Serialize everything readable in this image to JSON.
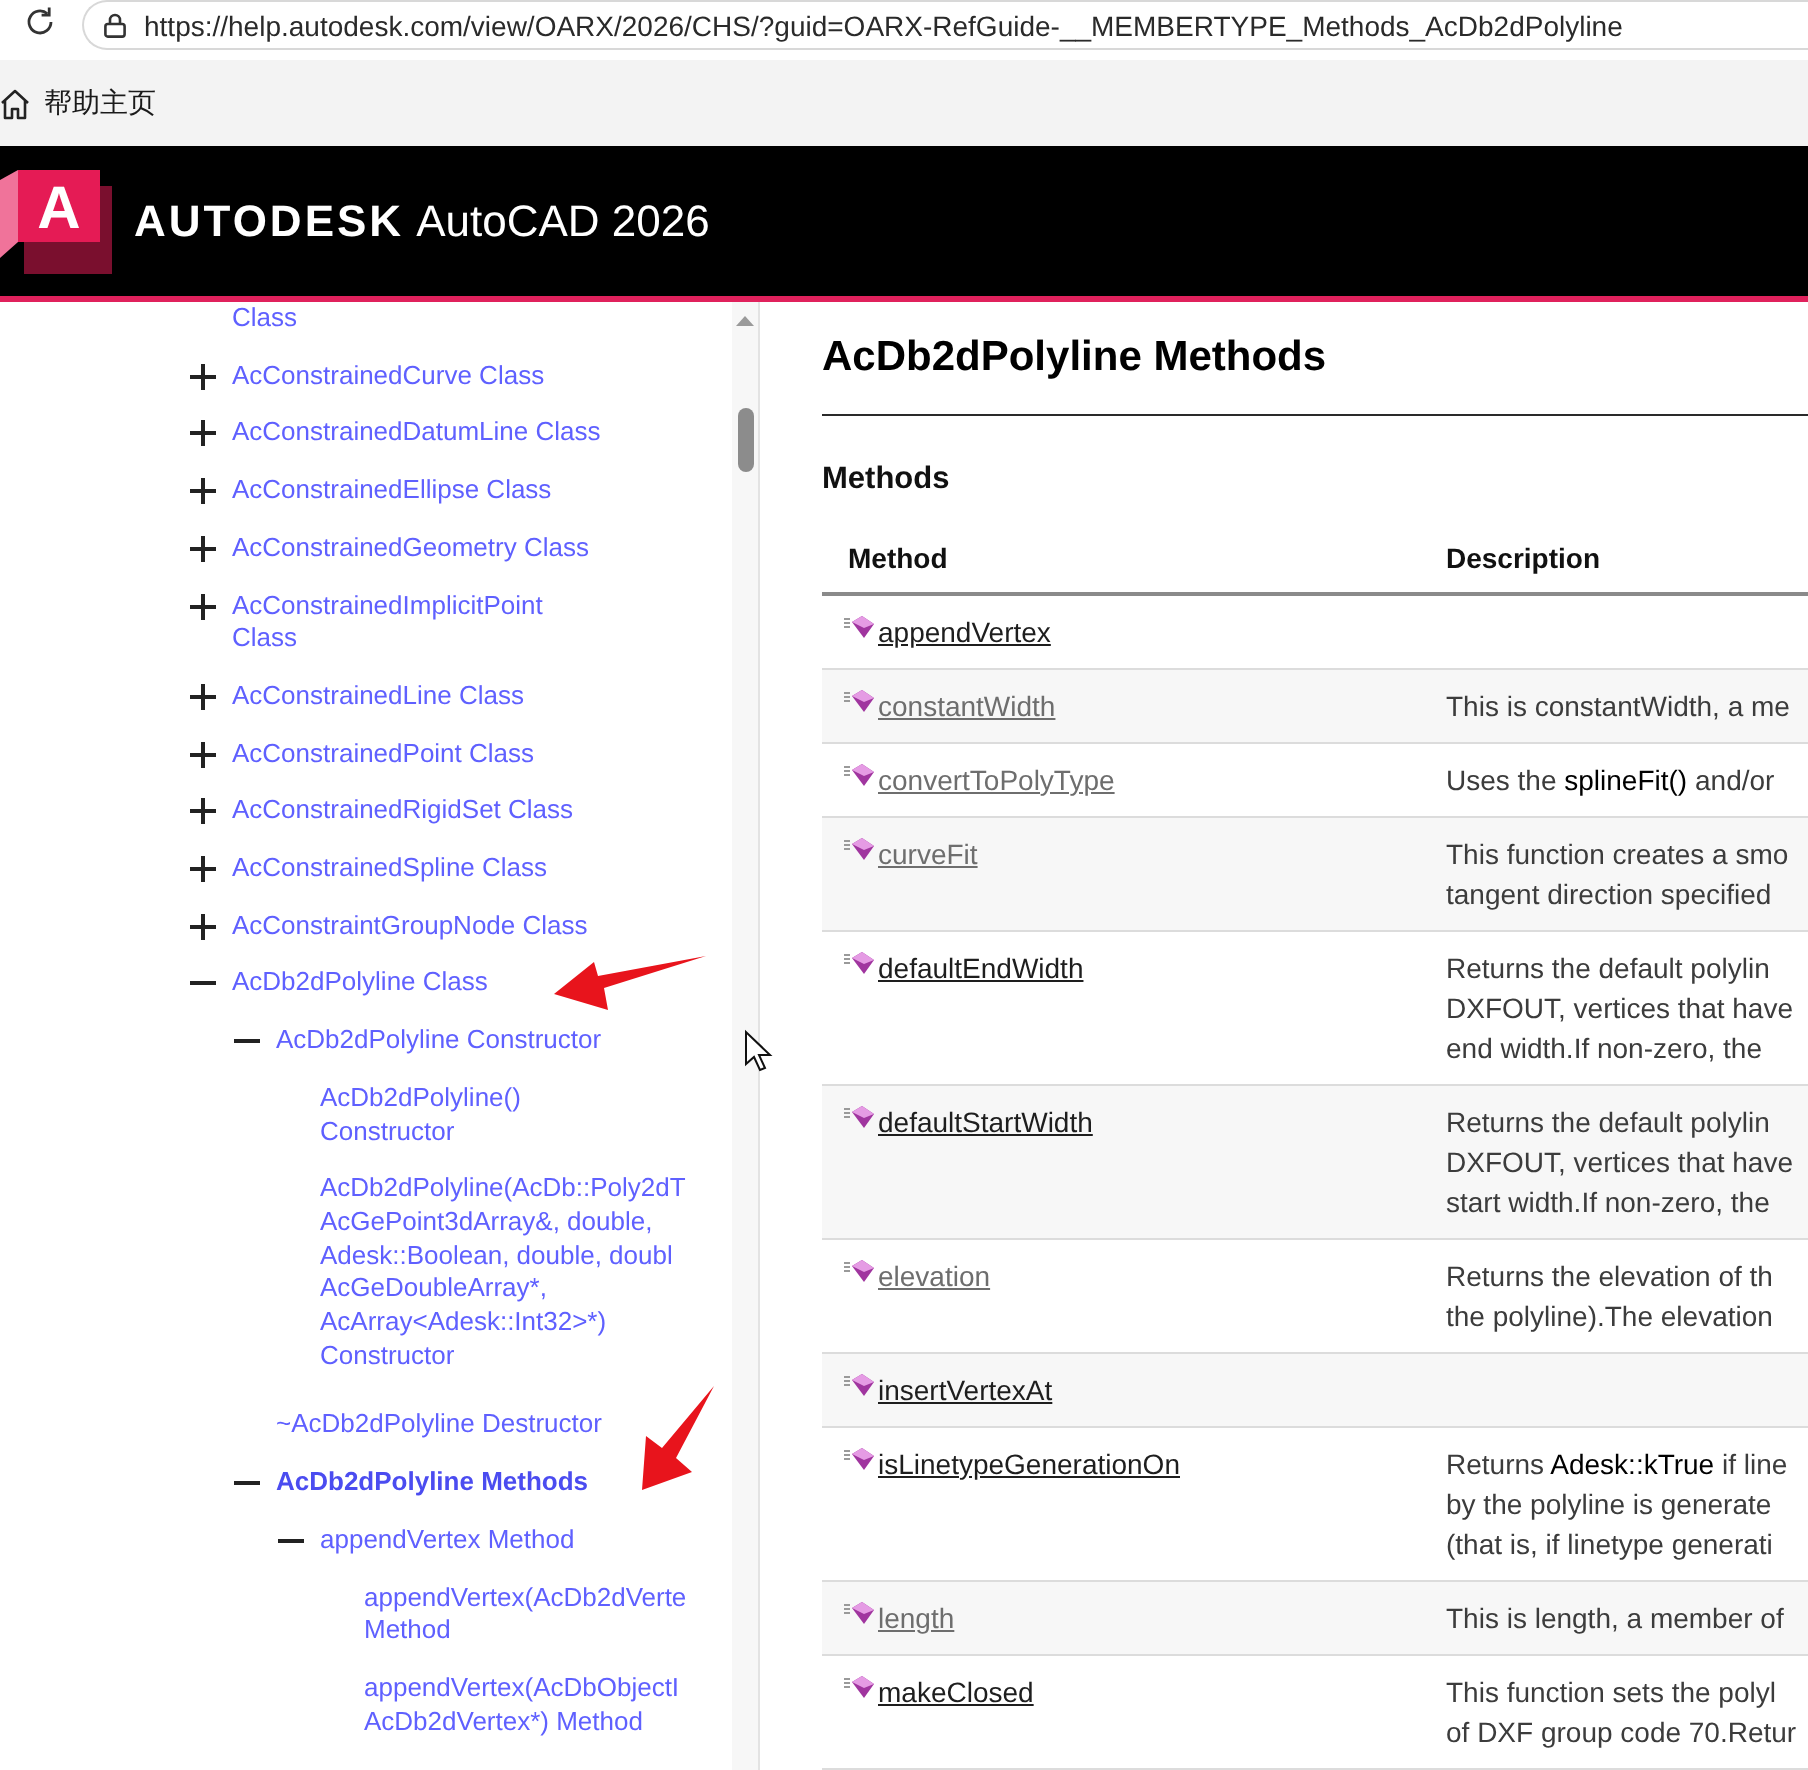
{
  "browser": {
    "url": "https://help.autodesk.com/view/OARX/2026/CHS/?guid=OARX-RefGuide-__MEMBERTYPE_Methods_AcDb2dPolyline"
  },
  "bookmarks_bar": {
    "items": [
      {
        "label": "帮助主页"
      }
    ]
  },
  "header": {
    "logo_letter": "A",
    "brand": "AUTODESK",
    "product": "AutoCAD 2026"
  },
  "sidebar": {
    "items": [
      {
        "kind": "fragment",
        "label": "Class",
        "selected": false
      },
      {
        "kind": "node",
        "label": "AcConstrainedCurve Class",
        "expanded": false,
        "selected": false
      },
      {
        "kind": "node",
        "label": "AcConstrainedDatumLine Class",
        "expanded": false,
        "selected": false
      },
      {
        "kind": "node",
        "label": "AcConstrainedEllipse Class",
        "expanded": false,
        "selected": false
      },
      {
        "kind": "node",
        "label": "AcConstrainedGeometry Class",
        "expanded": false,
        "selected": false
      },
      {
        "kind": "node",
        "label": "AcConstrainedImplicitPoint\nClass",
        "expanded": false,
        "selected": false
      },
      {
        "kind": "node",
        "label": "AcConstrainedLine Class",
        "expanded": false,
        "selected": false
      },
      {
        "kind": "node",
        "label": "AcConstrainedPoint Class",
        "expanded": false,
        "selected": false
      },
      {
        "kind": "node",
        "label": "AcConstrainedRigidSet Class",
        "expanded": false,
        "selected": false
      },
      {
        "kind": "node",
        "label": "AcConstrainedSpline Class",
        "expanded": false,
        "selected": false
      },
      {
        "kind": "node",
        "label": "AcConstraintGroupNode Class",
        "expanded": false,
        "selected": false
      },
      {
        "kind": "node",
        "label": "AcDb2dPolyline Class",
        "expanded": true,
        "selected": false,
        "children": [
          {
            "kind": "node",
            "label": "AcDb2dPolyline Constructor",
            "expanded": true,
            "selected": false,
            "children": [
              {
                "kind": "leaf",
                "label": "AcDb2dPolyline()\nConstructor",
                "selected": false
              },
              {
                "kind": "leaf",
                "label": "AcDb2dPolyline(AcDb::Poly2dT\nAcGePoint3dArray&, double,\nAdesk::Boolean, double, doubl\nAcGeDoubleArray*,\nAcArray<Adesk::Int32>*)\nConstructor",
                "selected": false
              }
            ]
          },
          {
            "kind": "leaf",
            "label": "~AcDb2dPolyline Destructor",
            "selected": false
          },
          {
            "kind": "node",
            "label": "AcDb2dPolyline Methods",
            "expanded": true,
            "selected": true,
            "children": [
              {
                "kind": "node",
                "label": "appendVertex Method",
                "expanded": true,
                "selected": false,
                "children": [
                  {
                    "kind": "leaf",
                    "label": "appendVertex(AcDb2dVerte\nMethod",
                    "selected": false
                  },
                  {
                    "kind": "leaf",
                    "label": "appendVertex(AcDbObjectI\nAcDb2dVertex*) Method",
                    "selected": false
                  }
                ]
              }
            ]
          }
        ]
      }
    ]
  },
  "content": {
    "title": "AcDb2dPolyline Methods",
    "section": "Methods",
    "table": {
      "columns": [
        "Method",
        "Description"
      ],
      "rows": [
        {
          "method": "appendVertex",
          "visited": false
        },
        {
          "method": "constantWidth",
          "visited": true,
          "description": "This is constantWidth, a me"
        },
        {
          "method": "convertToPolyType",
          "visited": true,
          "description": "Uses the **splineFit()** and/or"
        },
        {
          "method": "curveFit",
          "visited": true,
          "description": "This function creates a smo\ntangent direction specified"
        },
        {
          "method": "defaultEndWidth",
          "visited": false,
          "description": "Returns the default polylin\nDXFOUT, vertices that have\nend width.If non-zero, the"
        },
        {
          "method": "defaultStartWidth",
          "visited": false,
          "description": "Returns the default polylin\nDXFOUT, vertices that have\nstart width.If non-zero, the"
        },
        {
          "method": "elevation",
          "visited": true,
          "description": "Returns the elevation of th\nthe polyline).The elevation"
        },
        {
          "method": "insertVertexAt",
          "visited": false
        },
        {
          "method": "isLinetypeGenerationOn",
          "visited": false,
          "description": "Returns **Adesk::kTrue** if line\nby the polyline is generate\n(that is, if linetype generati"
        },
        {
          "method": "length",
          "visited": true,
          "description": "This is length, a member of"
        },
        {
          "method": "makeClosed",
          "visited": false,
          "description": "This function sets the polyl\nof DXF group code 70.Retur"
        }
      ]
    }
  }
}
